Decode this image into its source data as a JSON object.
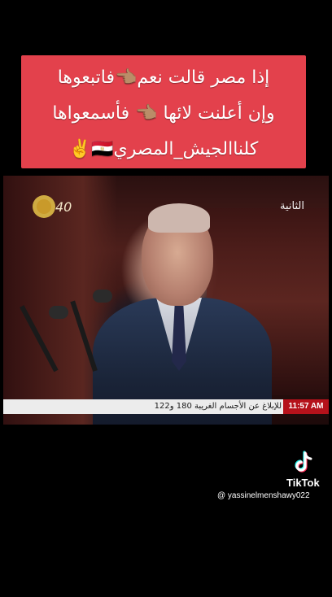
{
  "caption": {
    "line1": "إذا مصر  قالت  نعم👈🏽فاتبعوها",
    "line2": "وإن أعلنت لائها 👈🏽 فأسمعواها",
    "line3": "كلناالجيش_المصري🇪🇬✌️"
  },
  "video": {
    "channel_logo": "الثانية",
    "anniversary_badge": "40",
    "ticker_text": "للإبلاغ عن الأجسام الغريبة 180 و122",
    "ticker_time": "11:57 AM"
  },
  "watermark": {
    "brand": "TikTok",
    "handle": "@ yassinelmenshawy022"
  },
  "colors": {
    "caption_bg": "#e3414c",
    "background": "#000000",
    "ticker_time_bg": "#b5121b"
  }
}
